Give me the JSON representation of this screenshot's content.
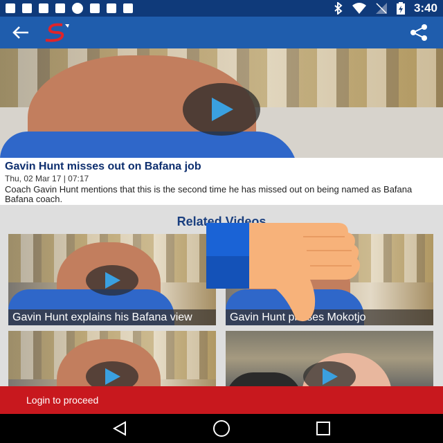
{
  "status_bar": {
    "time": "3:40",
    "icons_left": [
      "facebook-icon",
      "facebook-icon",
      "shield-icon",
      "facebook-icon",
      "info-icon",
      "no-signal-icon",
      "lock-icon",
      "game-icon"
    ],
    "icons_right": [
      "bluetooth-icon",
      "wifi-icon",
      "signal-off-icon",
      "battery-charging-icon"
    ]
  },
  "app_bar": {
    "back_icon": "arrow-left-icon",
    "logo": "supersport-logo",
    "share_icon": "share-icon",
    "color": "#1f5dad"
  },
  "article": {
    "title": "Gavin Hunt misses out on Bafana job",
    "date": "Thu, 02 Mar 17 | 07:17",
    "description": "Coach Gavin Hunt mentions that this is the second time he has missed out on being named as Bafana Bafana coach."
  },
  "related": {
    "heading": "Related Videos",
    "videos": [
      {
        "caption": "Gavin Hunt explains his Bafana view"
      },
      {
        "caption": "Gavin Hunt praises Mokotjo"
      },
      {
        "caption": ""
      },
      {
        "caption": ""
      }
    ]
  },
  "overlay": {
    "icon": "thumbs-down-icon"
  },
  "login_bar": {
    "label": "Login to proceed",
    "color": "#c8181e"
  },
  "nav_bar": {
    "buttons": [
      "back-triangle-icon",
      "home-circle-icon",
      "recents-square-icon"
    ]
  }
}
